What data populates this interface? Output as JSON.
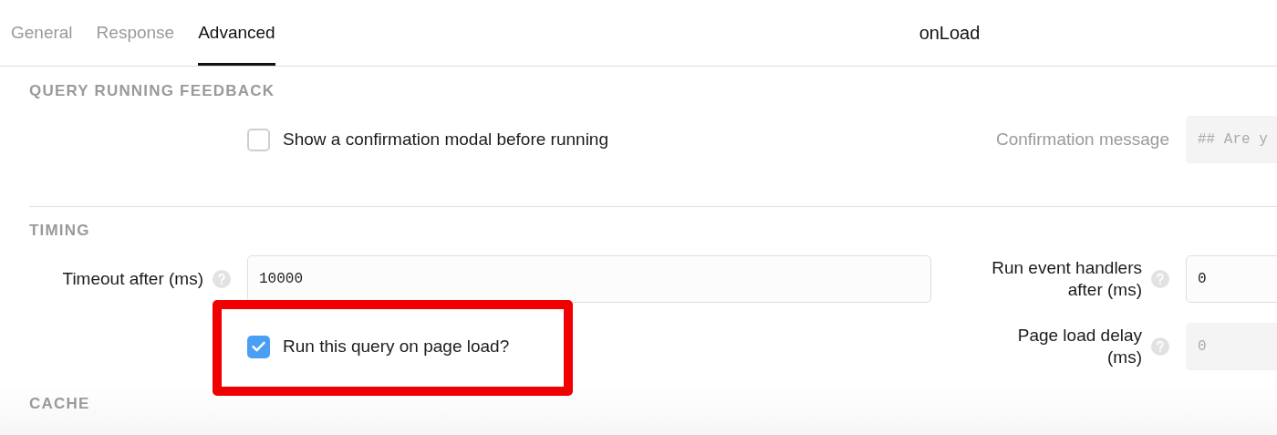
{
  "tabs": [
    {
      "label": "General",
      "selected": false
    },
    {
      "label": "Response",
      "selected": false
    },
    {
      "label": "Advanced",
      "selected": true
    }
  ],
  "title": "onLoad",
  "query_running_feedback": {
    "heading": "QUERY RUNNING FEEDBACK",
    "confirm_checkbox": {
      "label": "Show a confirmation modal before running",
      "checked": false,
      "highlighted": false
    },
    "confirmation_message": {
      "label": "Confirmation message",
      "placeholder": "## Are y"
    }
  },
  "timing": {
    "heading": "TIMING",
    "timeout": {
      "label": "Timeout after (ms)",
      "value": "10000"
    },
    "run_on_load": {
      "label": "Run this query on page load?",
      "checked": true,
      "highlighted": true
    },
    "event_handlers_delay": {
      "label": "Run event handlers after (ms)",
      "value": "0"
    },
    "page_load_delay": {
      "label": "Page load delay (ms)",
      "placeholder": "0"
    }
  },
  "cache": {
    "heading": "CACHE"
  }
}
